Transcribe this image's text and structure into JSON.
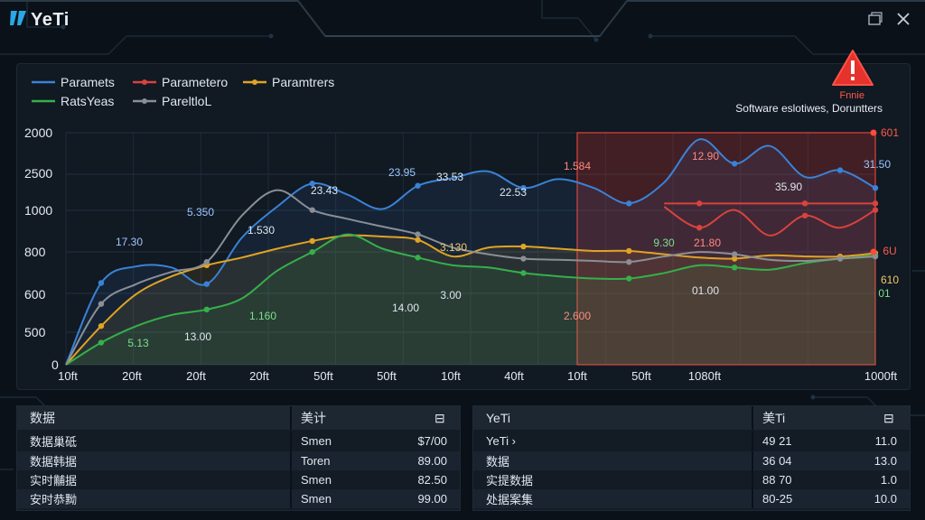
{
  "app": {
    "title": "YeTi",
    "restore_icon": "window-restore-icon",
    "close_icon": "close-icon"
  },
  "legend": [
    {
      "label": "Paramets",
      "color": "#3b82d6"
    },
    {
      "label": "Parametero",
      "color": "#d9433c"
    },
    {
      "label": "Paramtrers",
      "color": "#e0a325"
    },
    {
      "label": "RatsYeas",
      "color": "#35b04a"
    },
    {
      "label": "PareltloL",
      "color": "#8a8f96"
    }
  ],
  "alert": {
    "icon": "warning-icon",
    "color": "#e5322c",
    "label": "Fnnie",
    "text": "Software eslotiwes, Doruntters"
  },
  "chart_data": {
    "type": "line",
    "y_ticks": [
      "2000",
      "2500",
      "1000",
      "800",
      "600",
      "500",
      "0"
    ],
    "x_ticks": [
      "10ft",
      "20ft",
      "20ft",
      "20ft",
      "50ft",
      "50ft",
      "10ft",
      "40ft",
      "10ft",
      "50ft",
      "1080ft",
      "1000ft"
    ],
    "highlight_region": {
      "from_index": 8,
      "to_index": 11,
      "color": "#c0302a"
    },
    "series": [
      {
        "name": "Paramets",
        "color": "#3b82d6",
        "values": [
          0.0,
          0.74,
          0.89,
          0.88,
          0.73,
          1.15,
          1.43,
          1.64,
          1.54,
          1.41,
          1.62,
          1.69,
          1.75,
          1.6,
          1.68,
          1.6,
          1.46,
          1.65,
          2.04,
          1.82,
          1.98,
          1.7,
          1.76,
          1.6
        ]
      },
      {
        "name": "Parametero",
        "color": "#d9433c",
        "values": [
          null,
          null,
          null,
          null,
          null,
          null,
          null,
          null,
          null,
          null,
          null,
          null,
          null,
          null,
          null,
          null,
          null,
          1.43,
          1.24,
          1.4,
          1.17,
          1.35,
          1.24,
          1.4
        ]
      },
      {
        "name": "Paramtrers",
        "color": "#e0a325",
        "values": [
          0.0,
          0.35,
          0.64,
          0.8,
          0.9,
          0.97,
          1.05,
          1.12,
          1.17,
          1.16,
          1.13,
          0.98,
          1.06,
          1.07,
          1.05,
          1.03,
          1.03,
          1.0,
          0.97,
          0.96,
          0.99,
          0.98,
          0.98,
          1.01
        ]
      },
      {
        "name": "RatsYeas",
        "color": "#35b04a",
        "values": [
          0.0,
          0.2,
          0.35,
          0.45,
          0.5,
          0.6,
          0.85,
          1.02,
          1.18,
          1.05,
          0.97,
          0.9,
          0.88,
          0.83,
          0.8,
          0.78,
          0.78,
          0.83,
          0.9,
          0.88,
          0.86,
          0.92,
          0.96,
          0.99
        ]
      },
      {
        "name": "PareltloL",
        "color": "#8a8f96",
        "values": [
          0.0,
          0.55,
          0.73,
          0.84,
          0.93,
          1.35,
          1.58,
          1.4,
          1.32,
          1.25,
          1.18,
          1.06,
          1.0,
          0.96,
          0.95,
          0.94,
          0.93,
          0.98,
          1.02,
          1.0,
          0.95,
          0.94,
          0.96,
          0.98
        ]
      },
      {
        "name": "",
        "color": "#d9433c",
        "values": [
          null,
          null,
          null,
          null,
          null,
          null,
          null,
          null,
          null,
          null,
          null,
          null,
          null,
          null,
          null,
          null,
          null,
          1.46,
          1.46,
          1.46,
          1.46,
          1.46,
          1.46,
          1.46
        ]
      }
    ],
    "data_labels": [
      {
        "text": "17.30",
        "color": "#9ec8ff"
      },
      {
        "text": "5.350",
        "color": "#9ec8ff"
      },
      {
        "text": "1.530",
        "color": "#dfe6ee"
      },
      {
        "text": "23.43",
        "color": "#dfe6ee"
      },
      {
        "text": "23.95",
        "color": "#9ec8ff"
      },
      {
        "text": "33.53",
        "color": "#dfe6ee"
      },
      {
        "text": "22.53",
        "color": "#dfe6ee"
      },
      {
        "text": "1.584",
        "color": "#ff8a80"
      },
      {
        "text": "12.90",
        "color": "#ff8a80"
      },
      {
        "text": "35.90",
        "color": "#dfe6ee"
      },
      {
        "text": "31.50",
        "color": "#9ec8ff"
      },
      {
        "text": "3.130",
        "color": "#f1c766"
      },
      {
        "text": "9.30",
        "color": "#7be089"
      },
      {
        "text": "21.80",
        "color": "#ff8a80"
      },
      {
        "text": "01.00",
        "color": "#dfe6ee"
      },
      {
        "text": "1.160",
        "color": "#7be089"
      },
      {
        "text": "14.00",
        "color": "#dfe6ee"
      },
      {
        "text": "3.00",
        "color": "#dfe6ee"
      },
      {
        "text": "2.600",
        "color": "#ff8a80"
      },
      {
        "text": "5.13",
        "color": "#7be089"
      },
      {
        "text": "13.00",
        "color": "#dfe6ee"
      },
      {
        "text": "601",
        "color": "#ff5a4a"
      },
      {
        "text": "6U",
        "color": "#ff5a4a"
      },
      {
        "text": "610",
        "color": "#f1c766"
      },
      {
        "text": "01",
        "color": "#7be089"
      }
    ]
  },
  "table_left": {
    "headers": [
      "数据",
      "美计",
      "⊟"
    ],
    "rows": [
      [
        "数据巢砥",
        "Smen",
        "$7/00"
      ],
      [
        "数据韩据",
        "Toren",
        "89.00"
      ],
      [
        "实时黼据",
        "Smen",
        "82.50"
      ],
      [
        "安时恭黝",
        "Smen",
        "99.00"
      ]
    ]
  },
  "table_right": {
    "headers": [
      "YeTi",
      "美Ti",
      "⊟"
    ],
    "rows": [
      [
        "YeTi ›",
        "49 21",
        "11.0"
      ],
      [
        "数据",
        "36 04",
        "13.0"
      ],
      [
        "实提数据",
        "88 70",
        "1.0"
      ],
      [
        "处据案集",
        "80-25",
        "10.0"
      ]
    ]
  }
}
